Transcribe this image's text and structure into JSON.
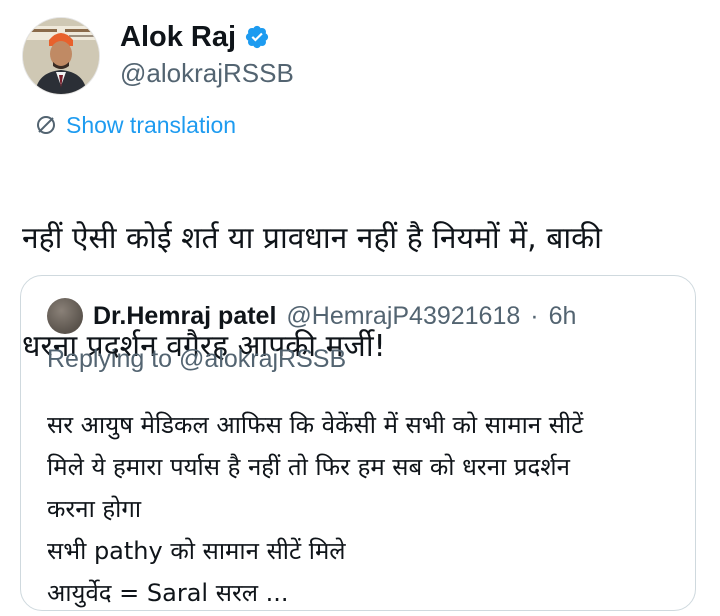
{
  "author": {
    "name": "Alok Raj",
    "handle": "@alokrajRSSB",
    "verified": true,
    "verified_color": "#1d9bf0"
  },
  "show_translation": "Show translation",
  "tweet_lines": [
    "नहीं ऐसी कोई शर्त या प्रावधान नहीं है नियमों में, बाकी",
    "धरना प्रदर्शन वगैरह आपकी मर्जी!"
  ],
  "quote": {
    "name": "Dr.Hemraj patel",
    "handle": "@HemrajP43921618",
    "separator": "·",
    "time": "6h",
    "replying_prefix": "Replying to ",
    "replying_to": "@alokrajRSSB",
    "lines": [
      "सर आयुष मेडिकल आफिस कि वेकेंसी में सभी को सामान सीटें",
      "मिले ये हमारा पर्यास है नहीं तो फिर हम सब को धरना प्रदर्शन",
      "करना होगा",
      "सभी pathy को सामान सीटें मिले",
      "आयुर्वेद =  Saral सरल ..."
    ]
  }
}
